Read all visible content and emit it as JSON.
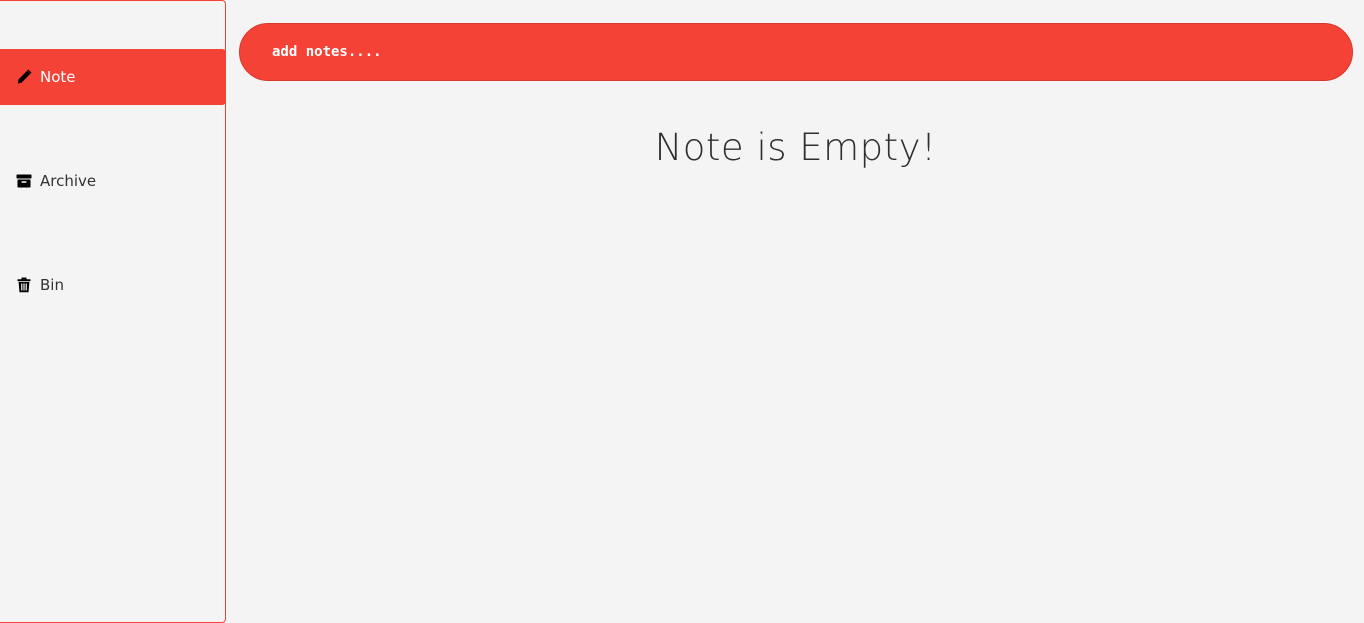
{
  "sidebar": {
    "items": [
      {
        "label": "Note",
        "icon": "pencil-icon",
        "active": true
      },
      {
        "label": "Archive",
        "icon": "archive-icon",
        "active": false
      },
      {
        "label": "Bin",
        "icon": "trash-icon",
        "active": false
      }
    ]
  },
  "main": {
    "input": {
      "value": "",
      "placeholder": "add notes...."
    },
    "empty_message": "Note is Empty!"
  },
  "colors": {
    "accent": "#f44336",
    "background": "#f4f4f4",
    "text": "#333333"
  }
}
